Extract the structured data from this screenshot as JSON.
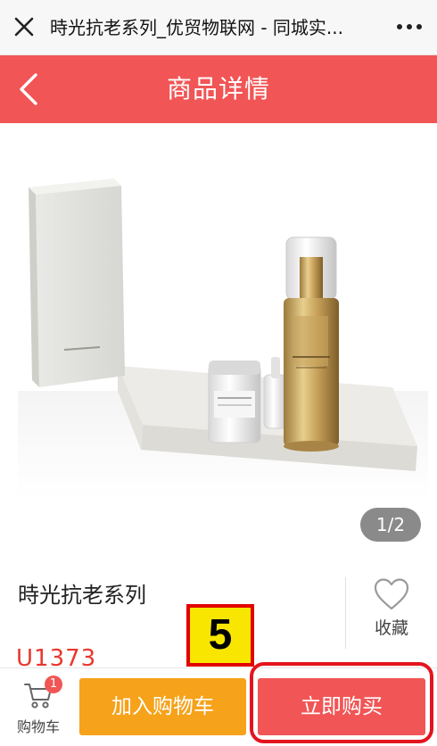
{
  "browser": {
    "title": "時光抗老系列_优贸物联网 - 同城实...",
    "close_icon": "close-icon",
    "more_icon": "more-dots-icon"
  },
  "nav": {
    "title": "商品详情",
    "back_icon": "chevron-left-icon"
  },
  "gallery": {
    "pager": "1/2"
  },
  "product": {
    "name": "時光抗老系列",
    "price": "U1373",
    "favorite_label": "收藏",
    "favorite_icon": "heart-outline-icon"
  },
  "annotation": {
    "step_number": "5"
  },
  "bottom_bar": {
    "cart_label": "购物车",
    "cart_count": "1",
    "add_to_cart": "加入购物车",
    "buy_now": "立即购买"
  },
  "colors": {
    "brand_red": "#f15555",
    "orange": "#f6a21a",
    "price_red": "#e8382d"
  }
}
